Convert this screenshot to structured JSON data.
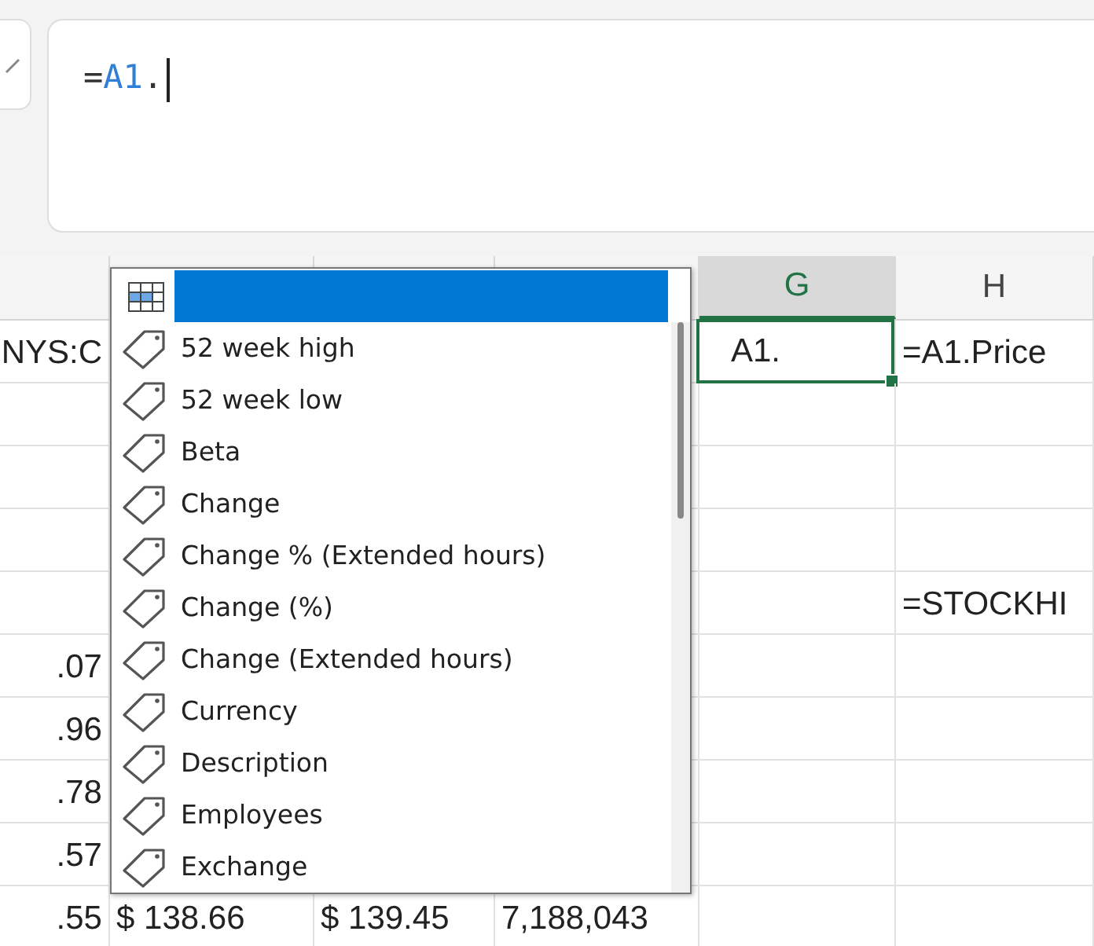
{
  "formula_bar": {
    "prefix": "=",
    "reference": "A1",
    "suffix": "."
  },
  "columns": [
    {
      "label": "G",
      "selected": true
    },
    {
      "label": "H",
      "selected": false
    }
  ],
  "rows": [
    {
      "cells": {
        "column_1": {
          "text": "NYS:C",
          "selected": false
        },
        "column_5": {
          "text": "A1.",
          "selected": true
        },
        "column_6": {
          "text": "=A1.Price",
          "selected": false
        }
      }
    },
    {
      "cells": {}
    },
    {
      "cells": {}
    },
    {
      "cells": {}
    },
    {
      "cells": {
        "column_6": {
          "text": "=STOCKHI",
          "selected": false
        }
      }
    },
    {
      "cells": {
        "column_1": {
          "text": ".07",
          "selected": false
        }
      }
    },
    {
      "cells": {
        "column_1": {
          "text": ".96",
          "selected": false
        }
      }
    },
    {
      "cells": {
        "column_1": {
          "text": ".78",
          "selected": false
        }
      }
    },
    {
      "cells": {
        "column_1": {
          "text": ".57",
          "selected": false
        }
      }
    },
    {
      "cells": {
        "column_1": {
          "text": ".55",
          "selected": false
        },
        "column_2": {
          "text": "$ 138.66",
          "selected": false
        },
        "column_3": {
          "text": "$ 139.45",
          "selected": false
        },
        "column_4": {
          "text": "7,188,043",
          "selected": false
        }
      }
    }
  ],
  "autocomplete": {
    "items": [
      {
        "kind": "table",
        "selected": true
      },
      {
        "kind": "field",
        "label": "52 week high",
        "selected": false
      },
      {
        "kind": "field",
        "label": "52 week low",
        "selected": false
      },
      {
        "kind": "field",
        "label": "Beta",
        "selected": false
      },
      {
        "kind": "field",
        "label": "Change",
        "selected": false
      },
      {
        "kind": "field",
        "label": "Change % (Extended hours)",
        "selected": false
      },
      {
        "kind": "field",
        "label": "Change (%)",
        "selected": false
      },
      {
        "kind": "field",
        "label": "Change (Extended hours)",
        "selected": false
      },
      {
        "kind": "field",
        "label": "Currency",
        "selected": false
      },
      {
        "kind": "field",
        "label": "Description",
        "selected": false
      },
      {
        "kind": "field",
        "label": "Employees",
        "selected": false
      },
      {
        "kind": "field",
        "label": "Exchange",
        "selected": false
      }
    ]
  }
}
